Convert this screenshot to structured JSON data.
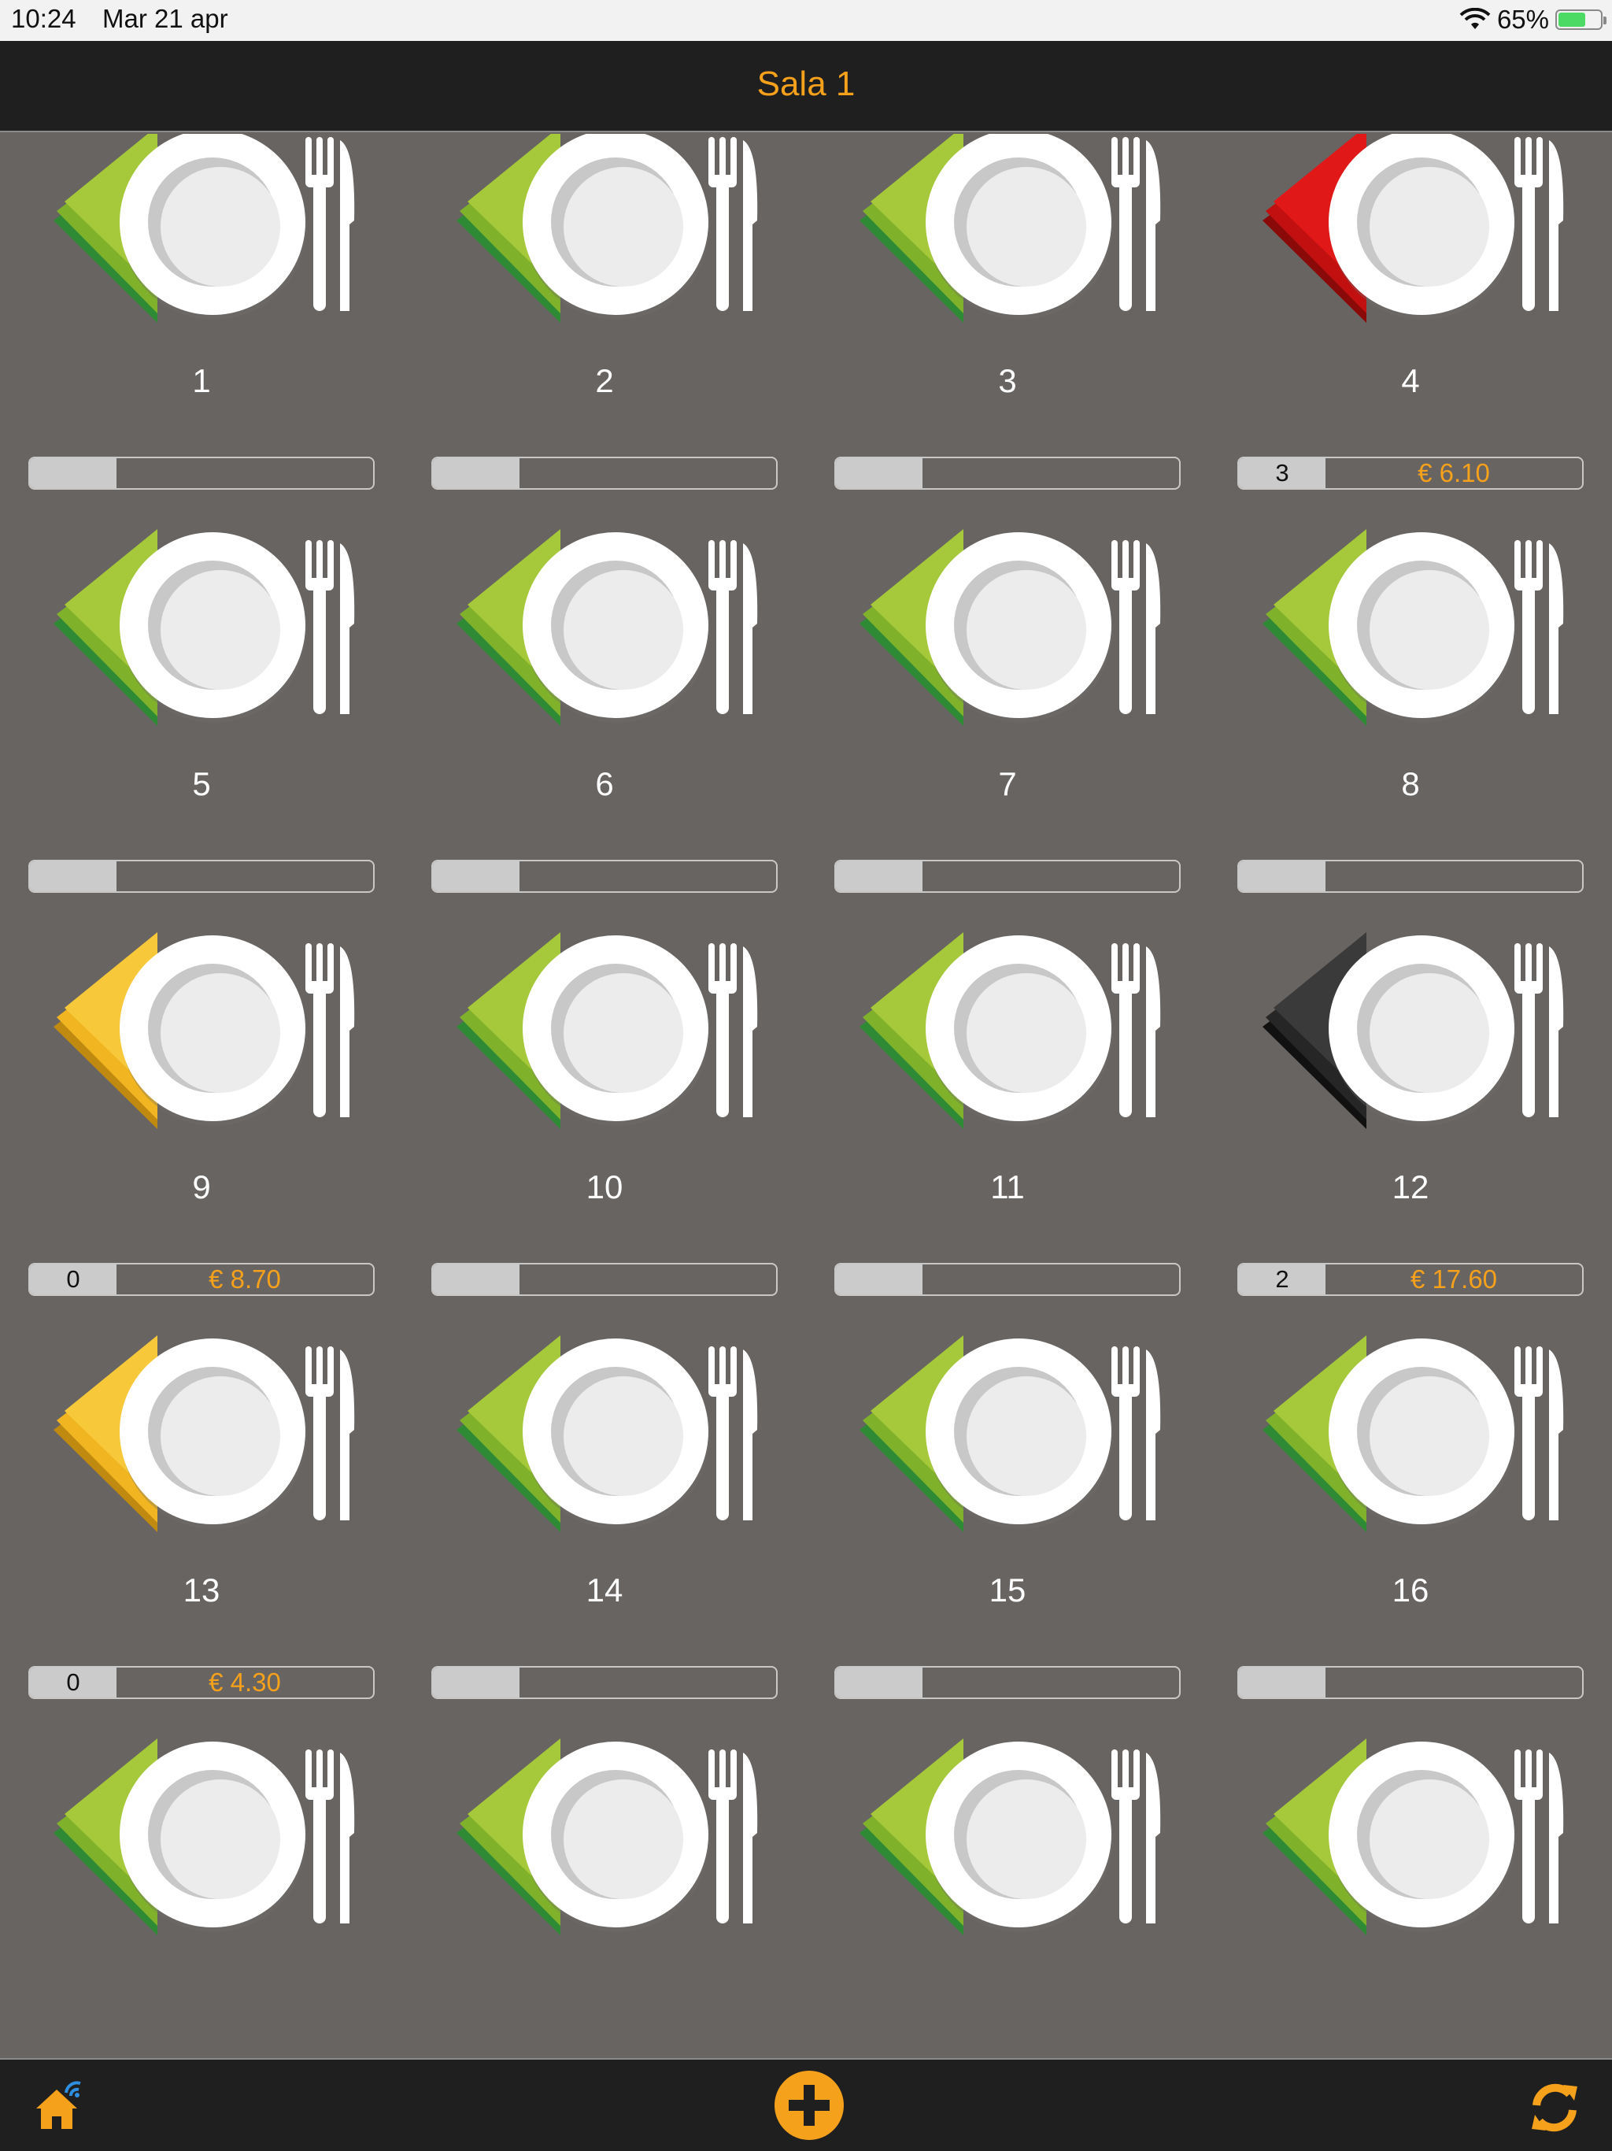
{
  "status_bar": {
    "time": "10:24",
    "date": "Mar 21 apr",
    "battery": "65%",
    "battery_level": 0.65
  },
  "header": {
    "title": "Sala 1"
  },
  "colors": {
    "accent": "#f5a11b",
    "green": "#8cbf2b",
    "red": "#d91414",
    "yellow": "#f5c532",
    "black": "#2a2a2a"
  },
  "tables": [
    {
      "number": "1",
      "napkin": "green",
      "count": "",
      "price": ""
    },
    {
      "number": "2",
      "napkin": "green",
      "count": "",
      "price": ""
    },
    {
      "number": "3",
      "napkin": "green",
      "count": "",
      "price": ""
    },
    {
      "number": "4",
      "napkin": "red",
      "count": "3",
      "price": "€ 6.10"
    },
    {
      "number": "5",
      "napkin": "green",
      "count": "",
      "price": ""
    },
    {
      "number": "6",
      "napkin": "green",
      "count": "",
      "price": ""
    },
    {
      "number": "7",
      "napkin": "green",
      "count": "",
      "price": ""
    },
    {
      "number": "8",
      "napkin": "green",
      "count": "",
      "price": ""
    },
    {
      "number": "9",
      "napkin": "yellow",
      "count": "0",
      "price": "€ 8.70"
    },
    {
      "number": "10",
      "napkin": "green",
      "count": "",
      "price": ""
    },
    {
      "number": "11",
      "napkin": "green",
      "count": "",
      "price": ""
    },
    {
      "number": "12",
      "napkin": "black",
      "count": "2",
      "price": "€ 17.60"
    },
    {
      "number": "13",
      "napkin": "yellow",
      "count": "0",
      "price": "€ 4.30"
    },
    {
      "number": "14",
      "napkin": "green",
      "count": "",
      "price": ""
    },
    {
      "number": "15",
      "napkin": "green",
      "count": "",
      "price": ""
    },
    {
      "number": "16",
      "napkin": "green",
      "count": "",
      "price": ""
    },
    {
      "number": "",
      "napkin": "green",
      "count": "",
      "price": ""
    },
    {
      "number": "",
      "napkin": "green",
      "count": "",
      "price": ""
    },
    {
      "number": "",
      "napkin": "green",
      "count": "",
      "price": ""
    },
    {
      "number": "",
      "napkin": "green",
      "count": "",
      "price": ""
    }
  ],
  "toolbar": {
    "home_icon": "home-wifi-icon",
    "add_icon": "plus-circle-icon",
    "sync_icon": "sync-icon"
  }
}
